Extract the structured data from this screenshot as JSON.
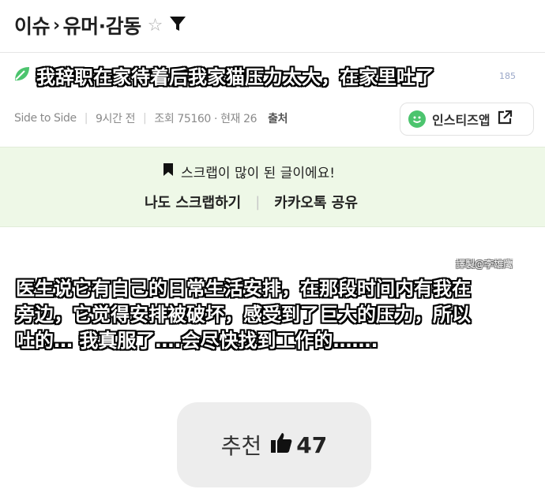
{
  "breadcrumb": {
    "root": "이슈",
    "separator": "›",
    "category": "유머·감동"
  },
  "post": {
    "title": "我辞职在家待着后我家猫压力太大，在家里吐了",
    "comment_count": "185",
    "author": "Side to Side",
    "time_ago": "9시간 전",
    "views": "조회 75160 · 현재 26",
    "source_label": "출처",
    "app_button": "인스티즈앱"
  },
  "scrap": {
    "message": "스크랩이 많이 된 글이에요!",
    "action_scrap": "나도 스크랩하기",
    "action_share": "카카오톡 공유"
  },
  "content": {
    "watermark": "譯製@李雄鹰",
    "body": "医生说它有自己的日常生活安排，在那段时间内有我在\n旁边，它觉得安排被破坏，感受到了巨大的压力，所以\n吐的… 我真服了….会尽快找到工作的……."
  },
  "recommend": {
    "label": "추천",
    "count": "47"
  },
  "colors": {
    "accent_green": "#4cc46e",
    "scrap_bg": "#eef8e7"
  }
}
